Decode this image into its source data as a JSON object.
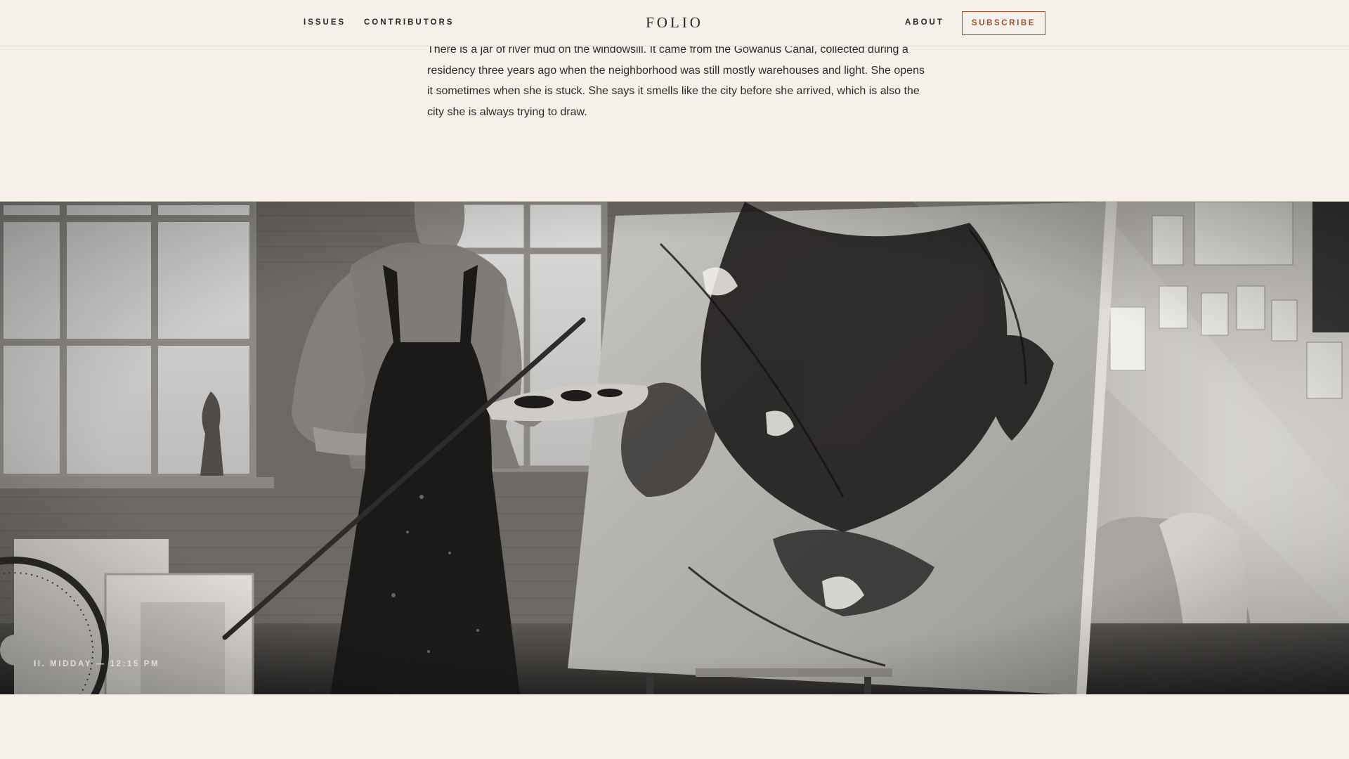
{
  "nav": {
    "issues": "ISSUES",
    "contributors": "CONTRIBUTORS",
    "brand": "FOLIO",
    "about": "ABOUT",
    "subscribe": "SUBSCRIBE"
  },
  "article": {
    "paragraph": "There is a jar of river mud on the windowsill. It came from the Gowanus Canal, collected during a residency three years ago when the neighborhood was still mostly warehouses and light. She opens it sometimes when she is stuck. She says it smells like the city before she arrived, which is also the city she is always trying to draw."
  },
  "photo": {
    "caption": "II. MIDDAY — 12:15 PM"
  },
  "colors": {
    "background": "#f5f1ea",
    "accent": "#9a4f33",
    "text": "#2b2622"
  }
}
